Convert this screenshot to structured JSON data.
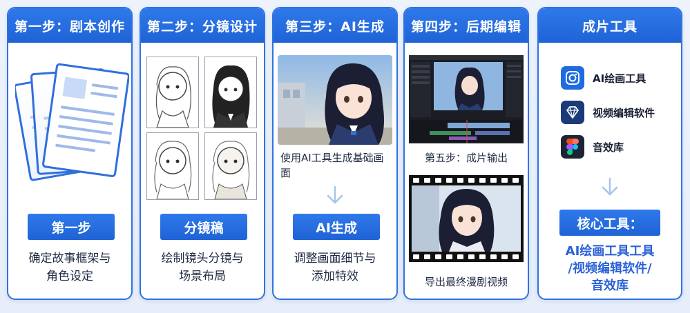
{
  "steps": {
    "s1": {
      "title": "第一步：剧本创作",
      "pill": "第一步",
      "desc_line1": "确定故事框架与",
      "desc_line2": "角色设定"
    },
    "s2": {
      "title": "第二步：分镜设计",
      "pill": "分镜稿",
      "desc_line1": "绘制镜头分镜与",
      "desc_line2": "场景布局"
    },
    "s3": {
      "title": "第三步：AI生成",
      "caption_line1": "使用AI工具生成基础画",
      "caption_line2": "面",
      "pill": "AI生成",
      "desc_line1": "调整画面细节与",
      "desc_line2": "添加特效"
    },
    "s4": {
      "title": "第四步：后期编辑",
      "caption": "第五步：成片输出",
      "caption_bottom": "导出最终漫剧视频"
    },
    "s5": {
      "title": "成片工具",
      "tools": [
        {
          "label": "AI绘画工具",
          "icon": "camera-icon"
        },
        {
          "label": "视频编辑软件",
          "icon": "diamond-icon"
        },
        {
          "label": "音效库",
          "icon": "figma-icon"
        }
      ],
      "pill": "核心工具：",
      "result_line1": "AI绘画工具工具",
      "result_line2": "/视频编辑软件/",
      "result_line3": "音效库"
    }
  },
  "colors": {
    "primary": "#1f63d6",
    "border": "#2f73e0",
    "text": "#1f2a44",
    "accent_text": "#2b62d8"
  }
}
